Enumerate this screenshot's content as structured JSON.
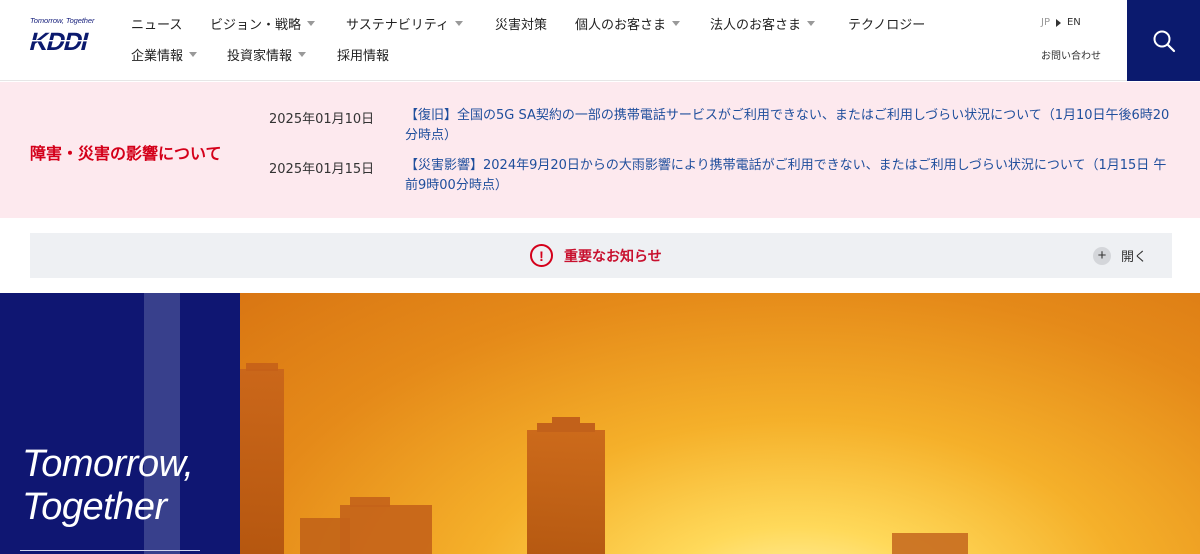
{
  "header": {
    "logo": {
      "tagline": "Tomorrow, Together",
      "wordmark": "KDDI"
    },
    "nav_row1": [
      {
        "label": "ニュース",
        "has_dropdown": false
      },
      {
        "label": "ビジョン・戦略",
        "has_dropdown": true
      },
      {
        "label": "サステナビリティ",
        "has_dropdown": true
      },
      {
        "label": "災害対策",
        "has_dropdown": false
      },
      {
        "label": "個人のお客さま",
        "has_dropdown": true
      },
      {
        "label": "法人のお客さま",
        "has_dropdown": true
      },
      {
        "label": "テクノロジー",
        "has_dropdown": false
      }
    ],
    "nav_row2": [
      {
        "label": "企業情報",
        "has_dropdown": true
      },
      {
        "label": "投資家情報",
        "has_dropdown": true
      },
      {
        "label": "採用情報",
        "has_dropdown": false
      }
    ],
    "lang": {
      "jp": "JP",
      "en": "EN"
    },
    "contact": "お問い合わせ",
    "search_icon": "search-icon"
  },
  "incident": {
    "title": "障害・災害の影響について",
    "items": [
      {
        "date": "2025年01月10日",
        "text": "【復旧】全国の5G SA契約の一部の携帯電話サービスがご利用できない、またはご利用しづらい状況について（1月10日午後6時20分時点）"
      },
      {
        "date": "2025年01月15日",
        "text": "【災害影響】2024年9月20日からの大雨影響により携帯電話がご利用できない、またはご利用しづらい状況について（1月15日 午前9時00分時点）"
      }
    ]
  },
  "notice": {
    "icon": "!",
    "label": "重要なお知らせ",
    "open_icon": "+",
    "open_label": "開く"
  },
  "hero": {
    "slogan_line1": "Tomorrow,",
    "slogan_line2": "Together"
  },
  "colors": {
    "brand_navy": "#0f1672",
    "alert_red": "#d4001a",
    "link_blue": "#1f4e9c",
    "incident_bg": "#fde9ee"
  }
}
